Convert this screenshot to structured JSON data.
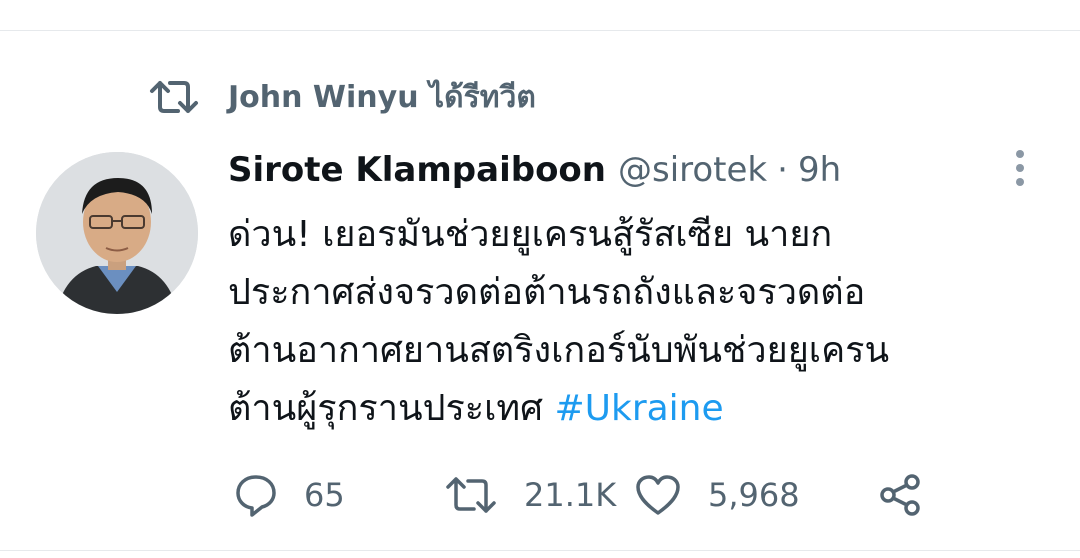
{
  "retweet_context": {
    "text": "John Winyu ได้รีทวีต"
  },
  "tweet": {
    "display_name": "Sirote Klampaiboon",
    "handle": "@sirotek",
    "separator": "·",
    "time": "9h",
    "text_lines": [
      "ด่วน! เยอรมันช่วยยูเครนสู้รัสเซีย นายก",
      "ประกาศส่งจรวดต่อต้านรถถังและจรวดต่อ",
      "ต้านอากาศยานสตริงเกอร์นับพันช่วยยูเครน",
      "ต้านผู้รุกรานประเทศ "
    ],
    "hashtag": "#Ukraine"
  },
  "actions": {
    "reply_count": "65",
    "retweet_count": "21.1K",
    "like_count": "5,968"
  },
  "colors": {
    "text": "#0f1419",
    "secondary": "#536471",
    "link": "#1d9bf0",
    "divider": "#e6e9ec"
  }
}
